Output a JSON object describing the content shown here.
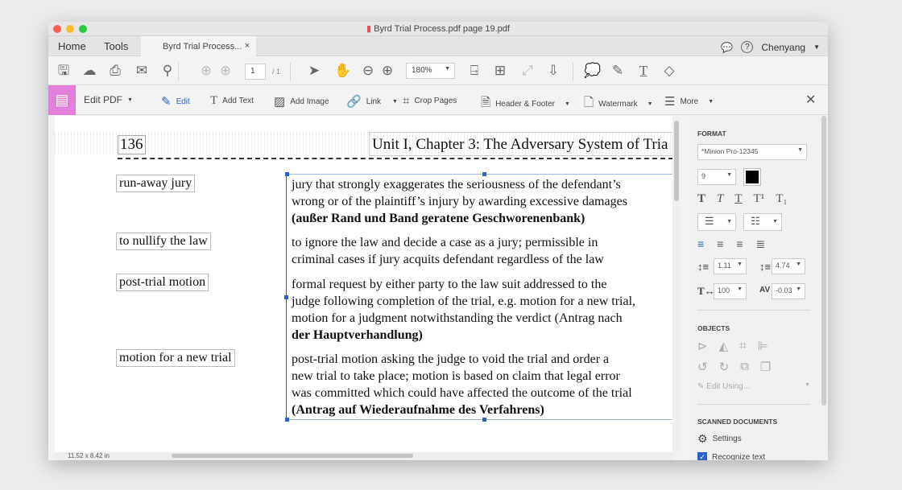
{
  "window": {
    "title": "Byrd Trial Process.pdf page 19.pdf"
  },
  "tabs": {
    "home": "Home",
    "tools": "Tools",
    "document": "Byrd Trial Process...",
    "close": "×"
  },
  "user": {
    "name": "Chenyang"
  },
  "toolbar": {
    "page_current": "1",
    "page_total": "/ 1",
    "zoom": "180%"
  },
  "editbar": {
    "title": "Edit PDF",
    "items": [
      "Edit",
      "Add Text",
      "Add Image",
      "Link",
      "Crop Pages",
      "Header & Footer",
      "Watermark",
      "More"
    ],
    "close": "✕"
  },
  "document": {
    "page_number": "136",
    "header": "Unit I, Chapter 3: The Adversary System of Tria",
    "terms": [
      "run-away jury",
      "to nullify the law",
      "post-trial motion",
      "motion for a new trial"
    ],
    "definitions": [
      [
        "jury that strongly exaggerates the seriousness of the defendant’s",
        "wrong or of the plaintiff’s injury by awarding excessive damages",
        "(außer Rand und Band geratene Geschworenenbank)"
      ],
      [
        "to ignore the law and decide a case as a jury; permissible in",
        "criminal cases if jury acquits defendant regardless of the law"
      ],
      [
        "formal request by either party to the law suit addressed to the",
        "judge following completion of the trial, e.g. motion for a new trial,",
        "motion for a judgment notwithstanding the verdict (Antrag nach",
        "der Hauptverhandlung)"
      ],
      [
        "post-trial motion asking the judge to void the trial and order a",
        "new trial to take place; motion is based on claim that legal error",
        "was committed which could have affected the outcome of the trial",
        "(Antrag auf Wiederaufnahme des Verfahrens)"
      ]
    ]
  },
  "status": {
    "page_size": "11.52 x 8.42 in"
  },
  "panel": {
    "format_heading": "FORMAT",
    "font": "*Minion Pro-12345",
    "font_size": "9",
    "text_color": "#000000",
    "line_spacing": "1.11",
    "paragraph_spacing": "4.74",
    "horizontal_scale": "100",
    "char_spacing": "-0.03",
    "objects_heading": "OBJECTS",
    "edit_using": "Edit Using...",
    "scanned_heading": "SCANNED DOCUMENTS",
    "settings": "Settings",
    "recognize_text": "Recognize text"
  },
  "colors": {
    "accent": "#2a62c9",
    "edit_pdf_tool": "#e27fd9"
  }
}
